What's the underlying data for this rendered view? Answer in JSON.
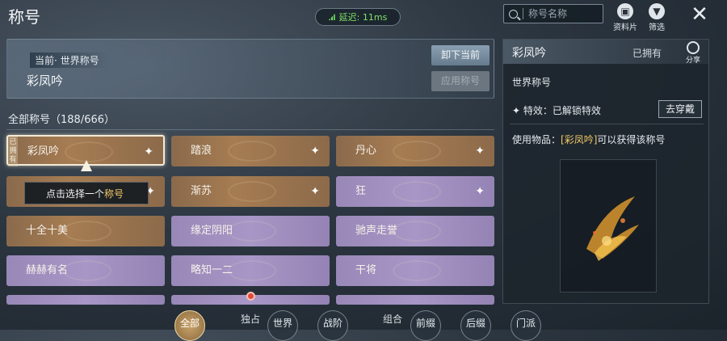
{
  "header": {
    "title": "称号",
    "latency": "延迟: 11ms",
    "search_placeholder": "称号名称",
    "profile_label": "资料片",
    "filter_label": "筛选"
  },
  "current": {
    "label": "当前· 世界称号",
    "name": "彩凤吟",
    "unload_label": "卸下当前",
    "apply_label": "应用称号"
  },
  "list": {
    "label": "全部称号（188/666）",
    "owned_tag": "已拥有",
    "tooltip_prefix": "点击选择一个",
    "tooltip_highlight": "称号",
    "tiles": [
      {
        "name": "彩凤吟"
      },
      {
        "name": "踏浪"
      },
      {
        "name": "丹心"
      },
      {
        "name": ""
      },
      {
        "name": "渐苏"
      },
      {
        "name": "狂"
      },
      {
        "name": "十全十美"
      },
      {
        "name": "缘定阴阳"
      },
      {
        "name": "驰声走誉"
      },
      {
        "name": "赫赫有名"
      },
      {
        "name": "略知一二"
      },
      {
        "name": "干将"
      }
    ]
  },
  "detail": {
    "name": "彩凤吟",
    "owned": "已拥有",
    "share_label": "分享",
    "category": "世界称号",
    "effect": "特效：已解锁特效",
    "wear_label": "去穿戴",
    "use_prefix": "使用物品：",
    "use_item": "[彩凤吟]",
    "use_suffix": "可以获得该称号"
  },
  "bottom": {
    "all": "全部",
    "solo": "独占",
    "world": "世界",
    "rank": "战阶",
    "combo": "组合",
    "prefix": "前缀",
    "suffix": "后缀",
    "sect": "门派"
  }
}
